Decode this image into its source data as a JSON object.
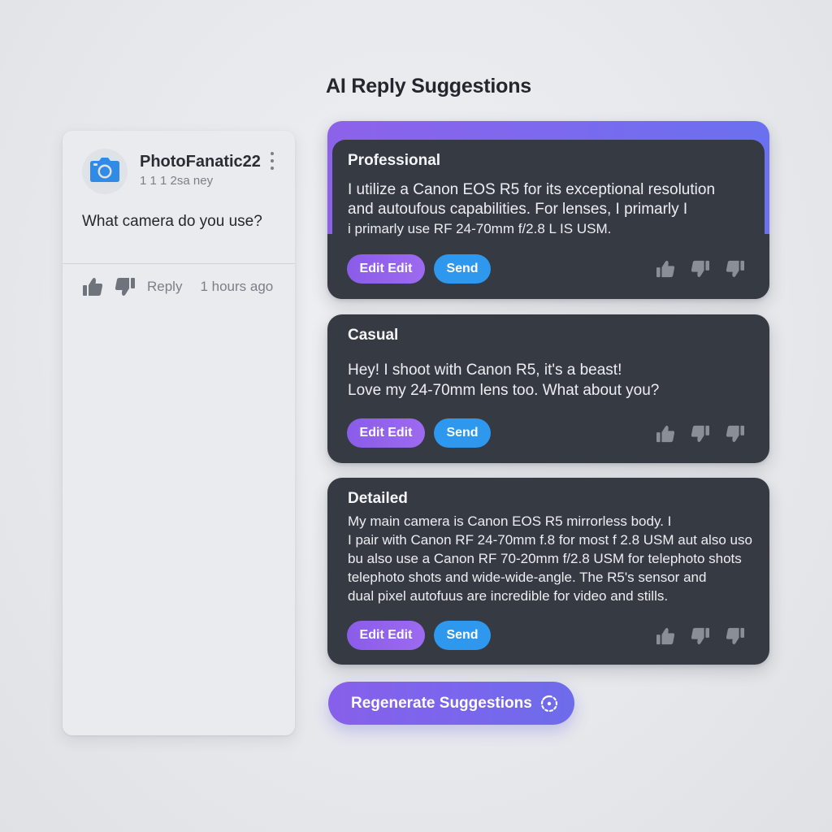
{
  "header": {
    "title": "AI Reply Suggestions"
  },
  "comment": {
    "avatar_icon": "camera-icon",
    "username": "PhotoFanatic22",
    "timestamp": "1 1 1 2sa ney",
    "text": "What camera do you use?",
    "reply_label": "Reply",
    "time_ago": "1 hours ago",
    "icons": {
      "like": "thumbs-up-icon",
      "dislike": "thumbs-down-icon",
      "more": "more-vertical-icon"
    }
  },
  "suggestions": [
    {
      "tone": "Professional",
      "lines": [
        "I utilize a Canon EOS R5 for its exceptional resolution",
        "and autoufous capabilities. For lenses, I primarly I",
        "i primarly use RF 24-70mm f/2.8 L IS USM."
      ],
      "edit_label": "Edit Edit",
      "send_label": "Send"
    },
    {
      "tone": "Casual",
      "lines": [
        "Hey! I shoot with Canon R5, it's a beast!",
        "Love my 24-70mm lens too. What about you?"
      ],
      "edit_label": "Edit Edit",
      "send_label": "Send"
    },
    {
      "tone": "Detailed",
      "lines": [
        "My main camera is Canon EOS R5 mirrorless body. I",
        "I pair with Canon RF 24-70mm f.8 for most f 2.8 USM aut also uso",
        "bu also use a Canon RF 70-20mm f/2.8 USM for telephoto shots",
        "telephoto shots and wide-wide-angle. The R5's sensor and",
        "dual pixel autofuus are incredible for video and stills."
      ],
      "edit_label": "Edit Edit",
      "send_label": "Send"
    }
  ],
  "rating_icons": [
    "thumbs-up-icon",
    "thumbs-down-icon",
    "thumbs-down-icon"
  ],
  "regenerate": {
    "label": "Regenerate Suggestions",
    "icon": "refresh-icon"
  },
  "colors": {
    "accent_purple": "#8a5ce8",
    "send_blue": "#2e97ee",
    "card_dark": "#363a42",
    "avatar_blue": "#2f8be6"
  }
}
